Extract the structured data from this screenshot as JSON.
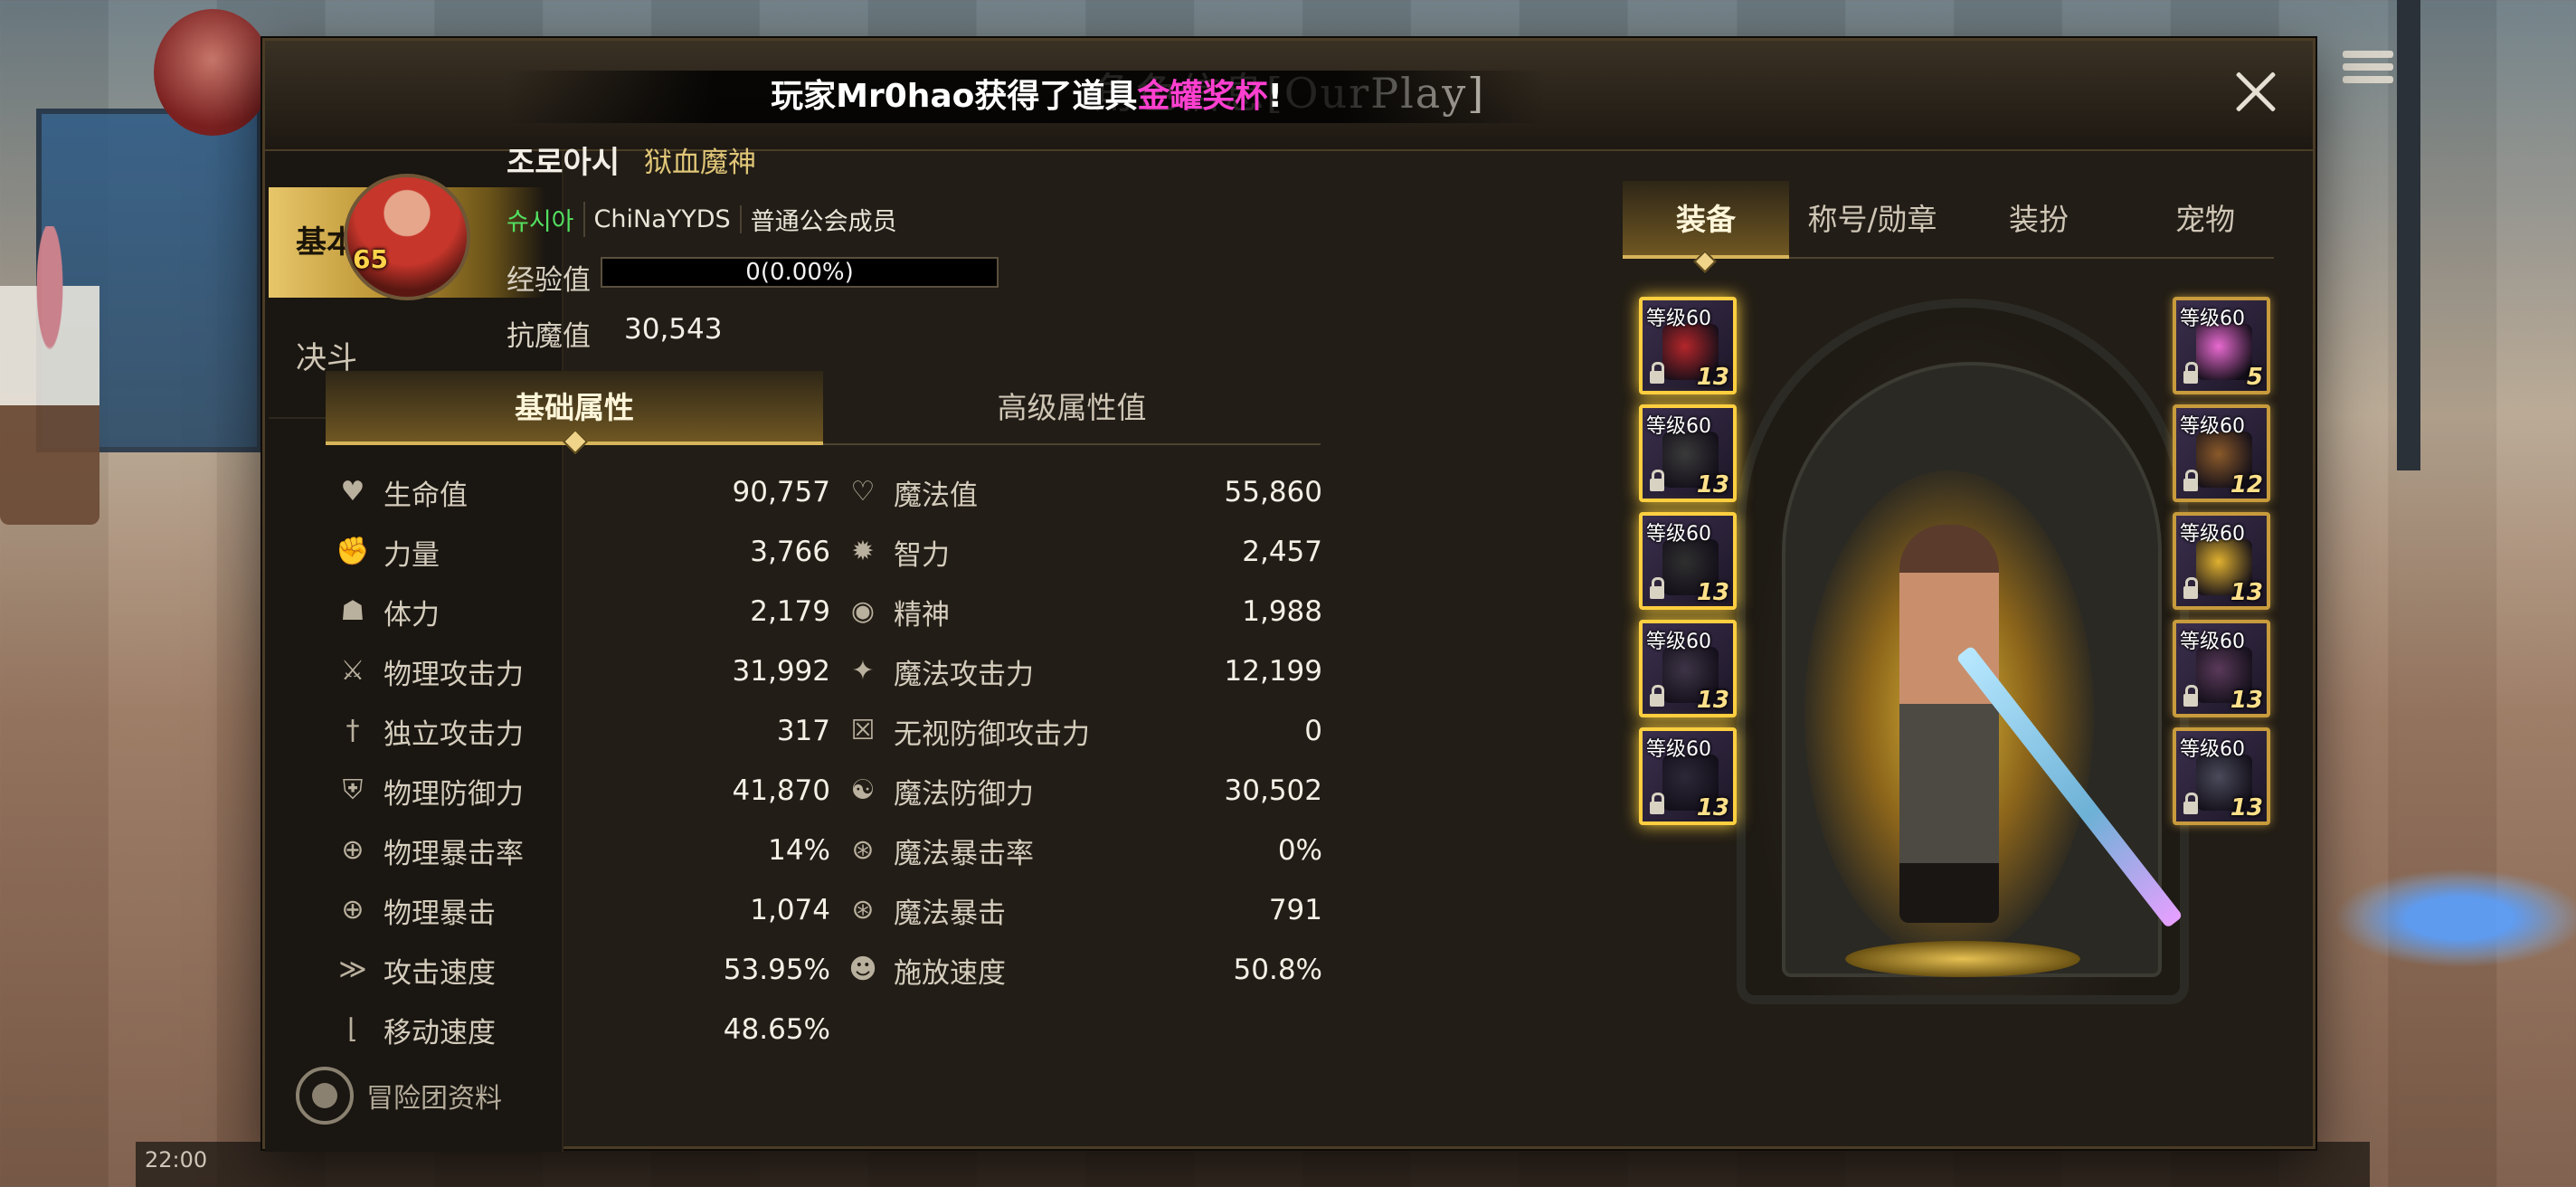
{
  "panel": {
    "title": "角色信息[OurPlay]",
    "broadcast_prefix": "玩家Mr0hao获得了道具",
    "broadcast_item": "金罐奖杯",
    "broadcast_suffix": "!"
  },
  "sidebar": {
    "tabs": [
      "基本",
      "决斗"
    ],
    "footer_label": "冒险团资料"
  },
  "background": {
    "clock": "22:00"
  },
  "profile": {
    "level": "65",
    "name": "조로아시",
    "class": "狱血魔神",
    "guild": "슈시아",
    "server": "ChiNaYYDS",
    "guild_rank": "普通公会成员",
    "exp_label": "经验值",
    "exp_text": "0(0.00%)",
    "exp_fraction": 0,
    "anti_magic_label": "抗魔值",
    "anti_magic_value": "30,543"
  },
  "attr_tabs": [
    "基础属性",
    "高级属性值"
  ],
  "stats": {
    "left": [
      {
        "label": "生命值",
        "value": "90,757",
        "icon": "heart-icon"
      },
      {
        "label": "力量",
        "value": "3,766",
        "icon": "fist-icon"
      },
      {
        "label": "体力",
        "value": "2,179",
        "icon": "body-icon"
      },
      {
        "label": "物理攻击力",
        "value": "31,992",
        "icon": "sword-icon"
      },
      {
        "label": "独立攻击力",
        "value": "317",
        "icon": "dagger-icon"
      },
      {
        "label": "物理防御力",
        "value": "41,870",
        "icon": "shield-icon"
      },
      {
        "label": "物理暴击率",
        "value": "14%",
        "icon": "crosshair-icon"
      },
      {
        "label": "物理暴击",
        "value": "1,074",
        "icon": "crosshair-icon"
      },
      {
        "label": "攻击速度",
        "value": "53.95%",
        "icon": "speed-sword-icon"
      },
      {
        "label": "移动速度",
        "value": "48.65%",
        "icon": "boot-icon"
      }
    ],
    "right": [
      {
        "label": "魔法值",
        "value": "55,860",
        "icon": "heart-outline-icon"
      },
      {
        "label": "智力",
        "value": "2,457",
        "icon": "burst-icon"
      },
      {
        "label": "精神",
        "value": "1,988",
        "icon": "eye-icon"
      },
      {
        "label": "魔法攻击力",
        "value": "12,199",
        "icon": "magic-star-icon"
      },
      {
        "label": "无视防御攻击力",
        "value": "0",
        "icon": "cross-shield-icon"
      },
      {
        "label": "魔法防御力",
        "value": "30,502",
        "icon": "yin-yang-icon"
      },
      {
        "label": "魔法暴击率",
        "value": "0%",
        "icon": "magic-crosshair-icon"
      },
      {
        "label": "魔法暴击",
        "value": "791",
        "icon": "magic-crosshair-icon"
      },
      {
        "label": "施放速度",
        "value": "50.8%",
        "icon": "head-icon"
      }
    ]
  },
  "equip_tabs": [
    "装备",
    "称号/勋章",
    "装扮",
    "宠物"
  ],
  "equipment": {
    "left": [
      {
        "level": "等级60",
        "enhance": "13",
        "color": "#b3262a"
      },
      {
        "level": "等级60",
        "enhance": "13",
        "color": "#3a3a3a"
      },
      {
        "level": "等级60",
        "enhance": "13",
        "color": "#2f2f2f"
      },
      {
        "level": "等级60",
        "enhance": "13",
        "color": "#3d3547"
      },
      {
        "level": "等级60",
        "enhance": "13",
        "color": "#2c2838"
      }
    ],
    "right": [
      {
        "level": "等级60",
        "enhance": "5",
        "color": "#e86ad0"
      },
      {
        "level": "等级60",
        "enhance": "12",
        "color": "#8a5a2a"
      },
      {
        "level": "等级60",
        "enhance": "13",
        "color": "#e0b130"
      },
      {
        "level": "等级60",
        "enhance": "13",
        "color": "#5a3a5a"
      },
      {
        "level": "等级60",
        "enhance": "13",
        "color": "#4a4a5a"
      }
    ]
  }
}
